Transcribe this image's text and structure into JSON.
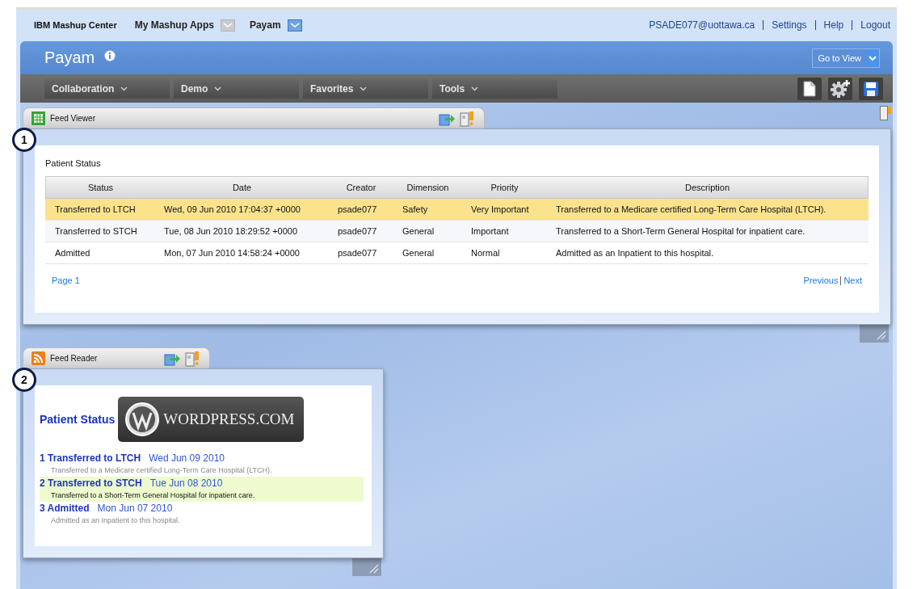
{
  "top_nav": {
    "brand": "IBM Mashup Center",
    "menus": [
      {
        "label": "My Mashup Apps",
        "selected": false
      },
      {
        "label": "Payam",
        "selected": true
      }
    ],
    "user": "PSADE077@uottawa.ca",
    "links": [
      "Settings",
      "Help",
      "Logout"
    ]
  },
  "header": {
    "title": "Payam",
    "view_button": "Go to View"
  },
  "menu": [
    "Collaboration",
    "Demo",
    "Favorites",
    "Tools"
  ],
  "feed_viewer": {
    "title": "Feed Viewer",
    "marker": "1",
    "heading": "Patient Status",
    "columns": [
      "Status",
      "Date",
      "Creator",
      "Dimension",
      "Priority",
      "Description"
    ],
    "rows": [
      {
        "selected": true,
        "cells": [
          "Transferred to LTCH",
          "Wed, 09 Jun 2010 17:04:37 +0000",
          "psade077",
          "Safety",
          "Very Important",
          "Transferred to a Medicare certified Long-Term Care Hospital (LTCH)."
        ]
      },
      {
        "selected": false,
        "cells": [
          "Transferred to STCH",
          "Tue, 08 Jun 2010 18:29:52 +0000",
          "psade077",
          "General",
          "Important",
          "Transferred to a Short-Term General Hospital for inpatient care."
        ]
      },
      {
        "selected": false,
        "cells": [
          "Admitted",
          "Mon, 07 Jun 2010 14:58:24 +0000",
          "psade077",
          "General",
          "Normal",
          "Admitted as an Inpatient to this hospital."
        ]
      }
    ],
    "page_label": "Page 1",
    "pager": [
      "Previous",
      "Next"
    ]
  },
  "feed_reader": {
    "title": "Feed Reader",
    "marker": "2",
    "heading": "Patient Status",
    "logo_text": "WORDPRESS.COM",
    "items": [
      {
        "number": "1",
        "title": "Transferred to LTCH",
        "date": "Wed Jun 09 2010",
        "description": "Transferred to a Medicare certified Long-Term Care Hospital (LTCH).",
        "selected": false
      },
      {
        "number": "2",
        "title": "Transferred to STCH",
        "date": "Tue Jun 08 2010",
        "description": "Transferred to a Short-Term General Hospital for inpatient care.",
        "selected": true
      },
      {
        "number": "3",
        "title": "Admitted",
        "date": "Mon Jun 07 2010",
        "description": "Admitted as an Inpatient to this hospital.",
        "selected": false
      }
    ]
  }
}
